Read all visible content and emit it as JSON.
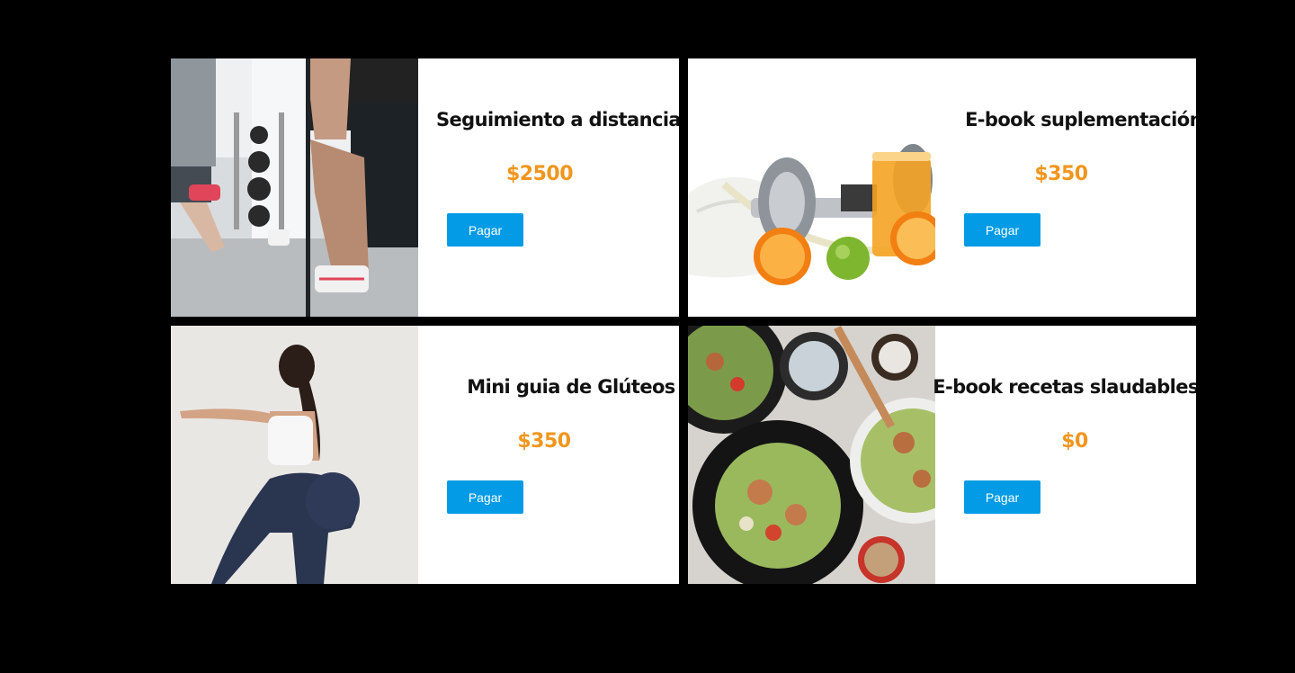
{
  "products": [
    {
      "title": "Seguimiento a distancia",
      "price": "$2500",
      "button_label": "Pagar",
      "image_icon": "gym-lunge-photo"
    },
    {
      "title": "E-book suplementación",
      "price": "$350",
      "button_label": "Pagar",
      "image_icon": "dumbbell-orange-juice-photo"
    },
    {
      "title": "Mini guia de Glúteos",
      "price": "$350",
      "button_label": "Pagar",
      "image_icon": "woman-squat-photo"
    },
    {
      "title": "E-book recetas slaudables",
      "price": "$0",
      "button_label": "Pagar",
      "image_icon": "salad-bowls-photo"
    }
  ],
  "colors": {
    "page_background": "#000000",
    "card_background": "#ffffff",
    "price": "#f0961e",
    "button": "#039be5",
    "button_text": "#ffffff",
    "title": "#111111"
  }
}
